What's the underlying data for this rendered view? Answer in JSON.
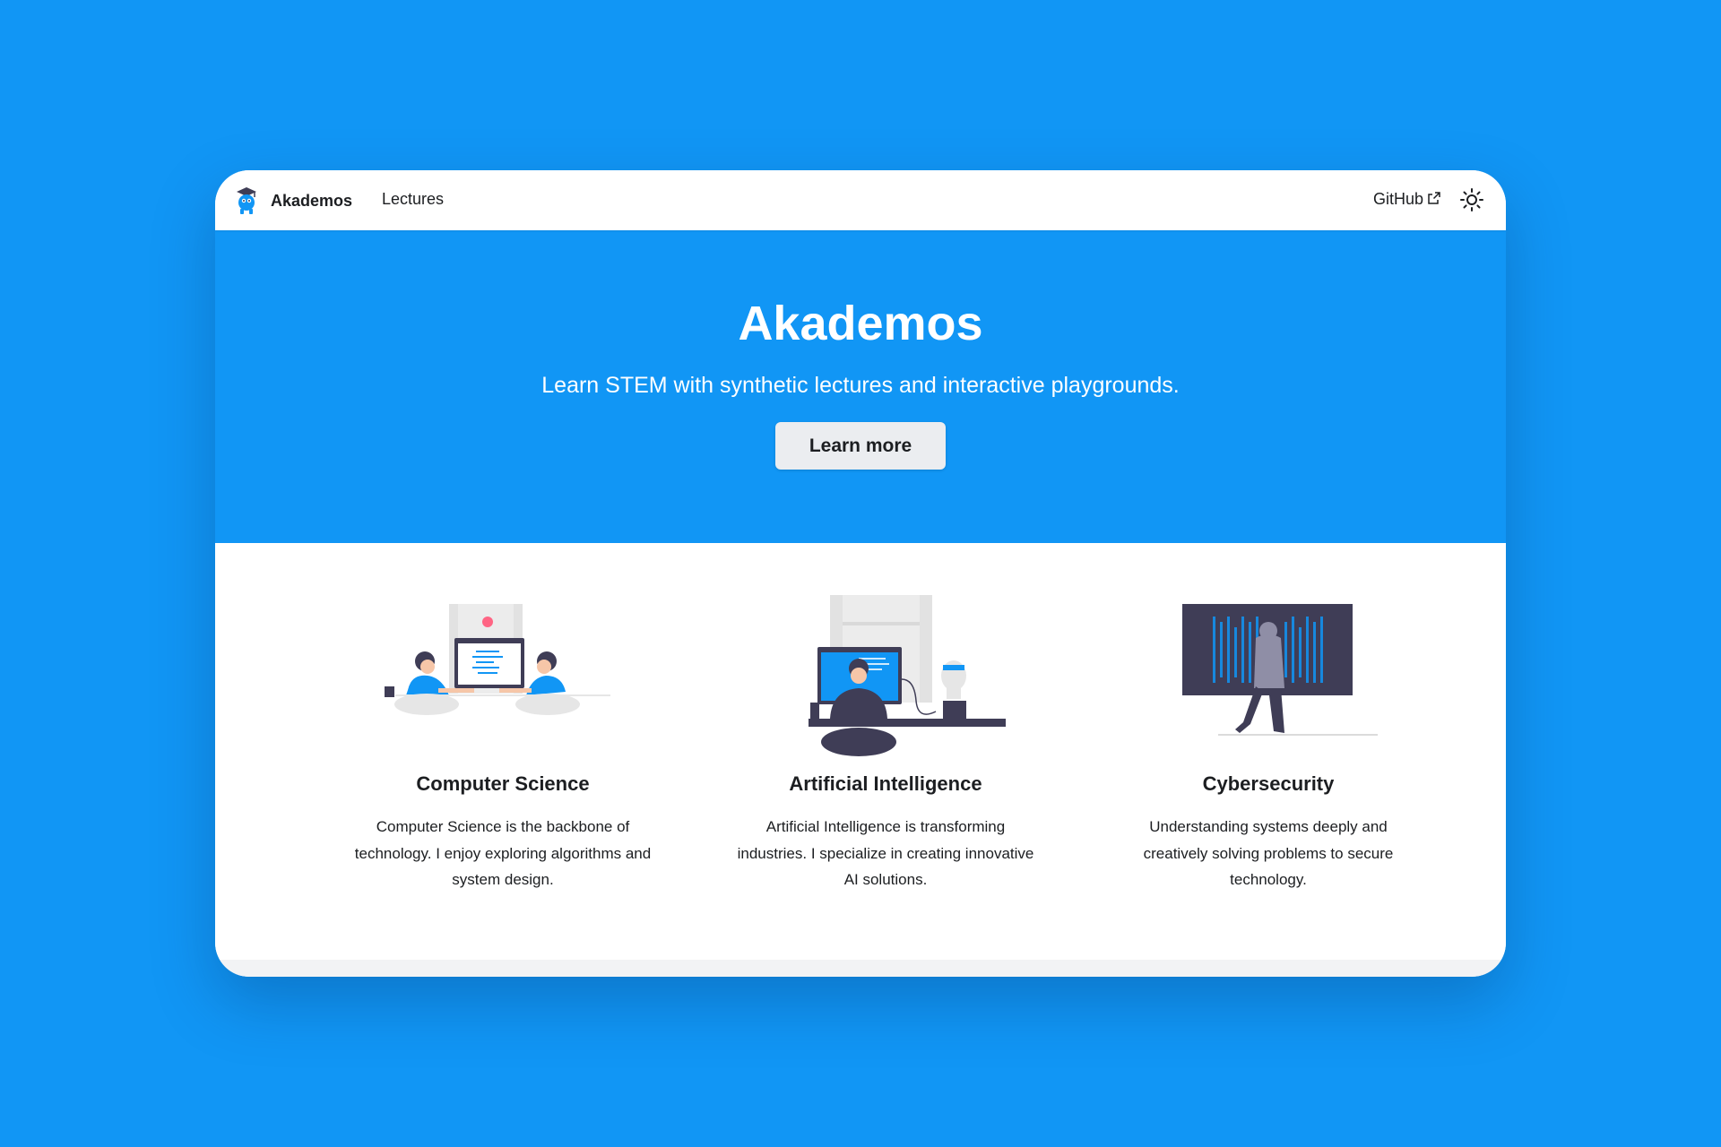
{
  "navbar": {
    "brand": "Akademos",
    "logo_icon": "akademos-mascot-logo",
    "links": [
      "Lectures"
    ],
    "github_label": "GitHub",
    "external_icon": "external-link-icon",
    "theme_icon": "sun-icon"
  },
  "hero": {
    "title": "Akademos",
    "tagline": "Learn STEM with synthetic lectures and interactive playgrounds.",
    "cta_label": "Learn more",
    "background_color": "#1196f5"
  },
  "features": [
    {
      "title": "Computer Science",
      "text": "Computer Science is the backbone of technology. I enjoy exploring algorithms and system design.",
      "illustration": "pair-programming-illustration"
    },
    {
      "title": "Artificial Intelligence",
      "text": "Artificial Intelligence is transforming industries. I specialize in creating innovative AI solutions.",
      "illustration": "ai-robot-illustration"
    },
    {
      "title": "Cybersecurity",
      "text": "Understanding systems deeply and creatively solving problems to secure technology.",
      "illustration": "hooded-hacker-illustration"
    }
  ],
  "colors": {
    "accent": "#1196f5",
    "text": "#1c1e21",
    "button_bg": "#ebedf0",
    "illustration_dark": "#3f3d56",
    "illustration_blue": "#1196f5"
  }
}
